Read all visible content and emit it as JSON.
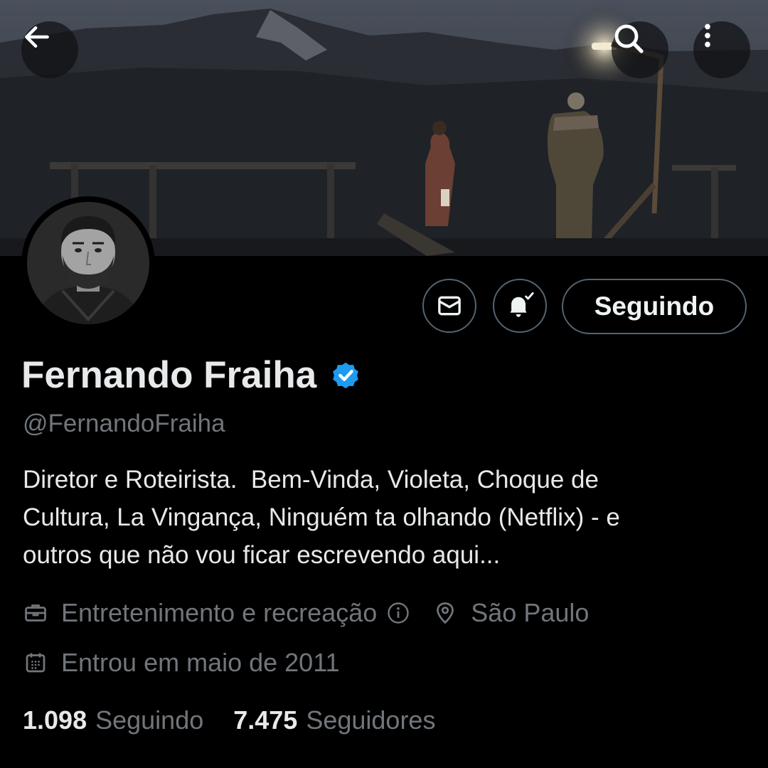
{
  "header": {
    "back_icon": "arrow-left-icon",
    "search_icon": "search-icon",
    "more_icon": "more-vertical-icon"
  },
  "actions": {
    "message_icon": "envelope-icon",
    "notify_icon": "bell-check-icon",
    "follow_label": "Seguindo"
  },
  "profile": {
    "display_name": "Fernando Fraiha",
    "verified": true,
    "handle": "@FernandoFraiha",
    "bio": "Diretor e Roteirista.  Bem-Vinda, Violeta, Choque de\nCultura, La Vingança, Ninguém ta olhando (Netflix) - e\noutros que não vou ficar escrevendo aqui...",
    "category": "Entretenimento e recreação",
    "location": "São Paulo",
    "joined": "Entrou em maio de 2011"
  },
  "stats": {
    "following_count": "1.098",
    "following_label": "Seguindo",
    "followers_count": "7.475",
    "followers_label": "Seguidores"
  },
  "colors": {
    "background": "#000000",
    "text_primary": "#e7e9ea",
    "text_secondary": "#71767b",
    "border": "#536471",
    "verified_blue": "#1d9bf0"
  }
}
